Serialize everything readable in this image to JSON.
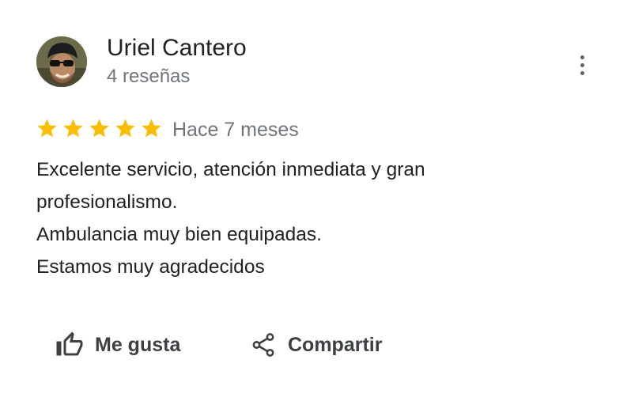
{
  "review": {
    "author": {
      "name": "Uriel Cantero",
      "review_count": "4 reseñas",
      "avatar_icon": "user-photo"
    },
    "rating": 5,
    "rating_max": 5,
    "date": "Hace 7 meses",
    "text_lines": [
      "Excelente servicio, atención inmediata y gran",
      "profesionalismo.",
      "Ambulancia muy bien equipadas.",
      "Estamos muy agradecidos"
    ],
    "star_color": "#fbbc04"
  },
  "actions": {
    "like_label": "Me gusta",
    "like_icon": "thumb-up-icon",
    "share_label": "Compartir",
    "share_icon": "share-icon",
    "more_icon": "more-vertical-icon"
  }
}
